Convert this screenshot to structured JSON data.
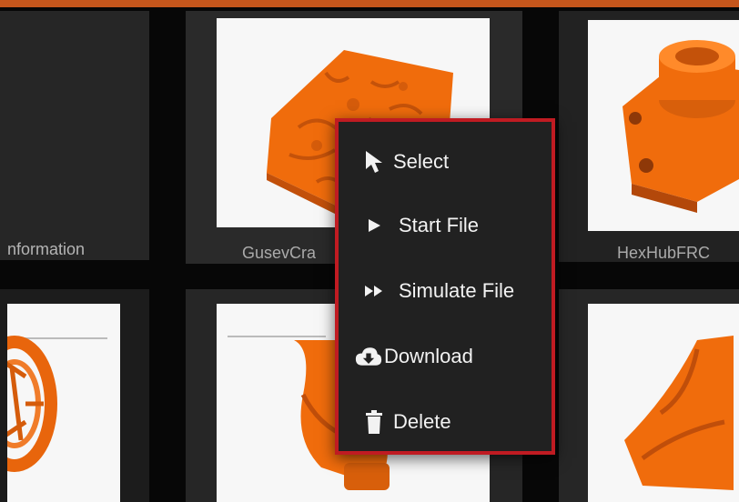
{
  "colors": {
    "accent": "#c5561c",
    "menu_border": "#c01b22",
    "model_orange": "#f06c0c"
  },
  "files": [
    {
      "name": "nformation",
      "thumbnail_icon": "blank"
    },
    {
      "name": "GusevCra",
      "thumbnail_icon": "terrain-model"
    },
    {
      "name": "HexHubFRC",
      "thumbnail_icon": "hex-hub-model"
    },
    {
      "name": "",
      "thumbnail_icon": "wheel-model"
    },
    {
      "name": "",
      "thumbnail_icon": "spiral-model"
    },
    {
      "name": "",
      "thumbnail_icon": "cone-model"
    }
  ],
  "context_menu": {
    "items": [
      {
        "label": "Select",
        "icon": "cursor-icon"
      },
      {
        "label": "Start File",
        "icon": "play-icon"
      },
      {
        "label": "Simulate File",
        "icon": "fast-forward-icon"
      },
      {
        "label": "Download",
        "icon": "cloud-download-icon"
      },
      {
        "label": "Delete",
        "icon": "trash-icon"
      }
    ]
  }
}
